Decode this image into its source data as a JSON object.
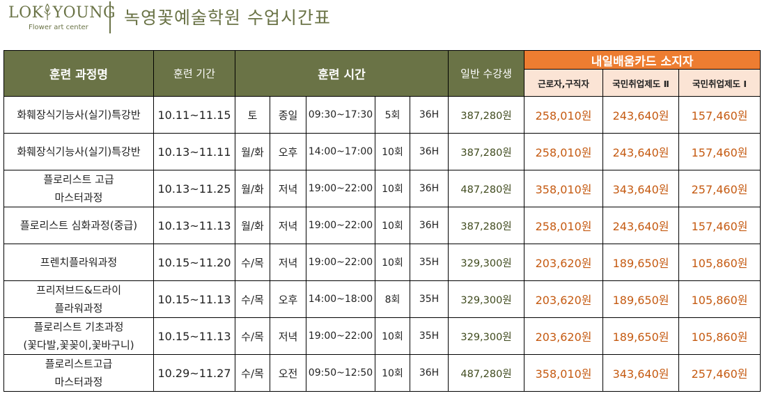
{
  "header": {
    "logo_text": "LOKYOUNG",
    "logo_left": "LOK",
    "logo_right": "YOUNG",
    "logo_subtitle": "Flower art center",
    "title": "녹영꽃예술학원 수업시간표",
    "accent_color": "#6a7346",
    "card_color": "#ed7d31",
    "card_text_color": "#c55a11"
  },
  "table": {
    "headers": {
      "course": "훈련 과정명",
      "period": "훈련 기간",
      "time": "훈련 시간",
      "general": "일반 수강생",
      "card_group": "내일배움카드 소지자",
      "card_worker": "근로자,구직자",
      "card_national2": "국민취업제도 Ⅱ",
      "card_national1": "국민취업제도 Ⅰ"
    },
    "rows": [
      {
        "course": [
          "화훼장식기능사(실기)특강반"
        ],
        "period": "10.11~11.15",
        "days": "토",
        "slot": "종일",
        "time": "09:30~17:30",
        "sessions": "5회",
        "hours": "36H",
        "general": "387,280원",
        "worker": "258,010원",
        "national2": "243,640원",
        "national1": "157,460원"
      },
      {
        "course": [
          "화훼장식기능사(실기)특강반"
        ],
        "period": "10.13~11.11",
        "days": "월/화",
        "slot": "오후",
        "time": "14:00~17:00",
        "sessions": "10회",
        "hours": "36H",
        "general": "387,280원",
        "worker": "258,010원",
        "national2": "243,640원",
        "national1": "157,460원"
      },
      {
        "course": [
          "플로리스트 고급",
          "마스터과정"
        ],
        "period": "10.13~11.25",
        "days": "월/화",
        "slot": "저녁",
        "time": "19:00~22:00",
        "sessions": "10회",
        "hours": "36H",
        "general": "487,280원",
        "worker": "358,010원",
        "national2": "343,640원",
        "national1": "257,460원"
      },
      {
        "course": [
          "플로리스트 심화과정(중급)"
        ],
        "period": "10.13~11.13",
        "days": "월/화",
        "slot": "저녁",
        "time": "19:00~22:00",
        "sessions": "10회",
        "hours": "36H",
        "general": "387,280원",
        "worker": "258,010원",
        "national2": "243,640원",
        "national1": "157,460원"
      },
      {
        "course": [
          "프렌치플라워과정"
        ],
        "period": "10.15~11.20",
        "days": "수/목",
        "slot": "저녁",
        "time": "19:00~22:00",
        "sessions": "10회",
        "hours": "35H",
        "general": "329,300원",
        "worker": "203,620원",
        "national2": "189,650원",
        "national1": "105,860원"
      },
      {
        "course": [
          "프리저브드&드라이",
          "플라워과정"
        ],
        "period": "10.15~11.13",
        "days": "수/목",
        "slot": "오후",
        "time": "14:00~18:00",
        "sessions": "8회",
        "hours": "35H",
        "general": "329,300원",
        "worker": "203,620원",
        "national2": "189,650원",
        "national1": "105,860원"
      },
      {
        "course": [
          "플로리스트 기초과정",
          "(꽃다발,꽃꽂이,꽃바구니)"
        ],
        "period": "10.15~11.13",
        "days": "수/목",
        "slot": "저녁",
        "time": "19:00~22:00",
        "sessions": "10회",
        "hours": "35H",
        "general": "329,300원",
        "worker": "203,620원",
        "national2": "189,650원",
        "national1": "105,860원"
      },
      {
        "course": [
          "플로리스트고급",
          "마스터과정"
        ],
        "period": "10.29~11.27",
        "days": "수/목",
        "slot": "오전",
        "time": "09:50~12:50",
        "sessions": "10회",
        "hours": "36H",
        "general": "487,280원",
        "worker": "358,010원",
        "national2": "343,640원",
        "national1": "257,460원"
      }
    ]
  }
}
